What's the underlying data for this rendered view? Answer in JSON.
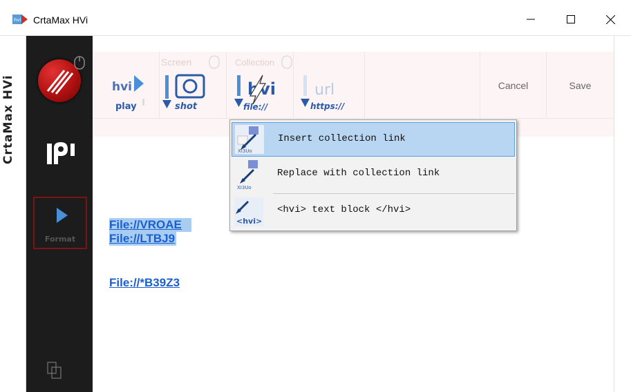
{
  "window": {
    "title": "CrtaMax HVi"
  },
  "brand": {
    "vertical_label": "CrtaMax HVi"
  },
  "sidebar": {
    "format_label": "Format"
  },
  "toolbar": {
    "hvi_play": {
      "top": "hvi",
      "bottom": "play"
    },
    "screenshot": {
      "top": "Screen",
      "bottom": "shot"
    },
    "collection": {
      "top": "Collection",
      "mid": "hvi",
      "bottom": "file://"
    },
    "url": {
      "top": "url",
      "bottom": "https://"
    },
    "cancel_label": "Cancel",
    "save_label": "Save"
  },
  "content": {
    "links": [
      "File://VROAE",
      "File://LTBJ9",
      "File://*B39Z3"
    ]
  },
  "context_menu": {
    "items": [
      {
        "label": "Insert collection link",
        "icon": "insert-collection-link-icon",
        "icon_caption": "XI3Uo"
      },
      {
        "label": "Replace with collection link",
        "icon": "replace-collection-link-icon",
        "icon_caption": "XI3Uo"
      },
      {
        "label": "<hvi> text block </hvi>",
        "icon": "hvi-text-block-icon",
        "icon_caption": "<hvi>"
      }
    ]
  },
  "colors": {
    "accent": "#1a5fd0",
    "selection": "#a9cdf0",
    "menu_hover": "#b8d6f2",
    "brand_red": "#b01010"
  }
}
